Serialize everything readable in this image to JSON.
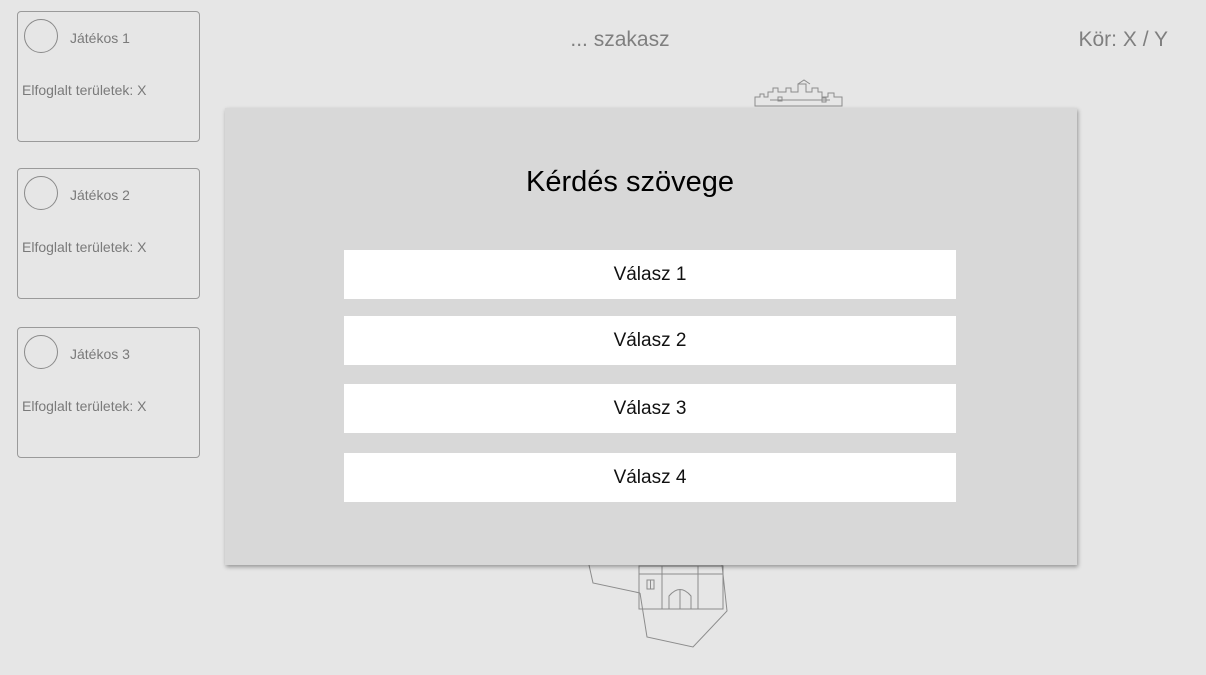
{
  "header": {
    "phase": "... szakasz",
    "round": "Kör: X / Y"
  },
  "players": [
    {
      "name": "Játékos 1",
      "territories": "Elfoglalt területek: X"
    },
    {
      "name": "Játékos 2",
      "territories": "Elfoglalt területek: X"
    },
    {
      "name": "Játékos 3",
      "territories": "Elfoglalt területek: X"
    }
  ],
  "question": {
    "text": "Kérdés szövege",
    "answers": [
      "Válasz 1",
      "Válasz 2",
      "Válasz 3",
      "Válasz 4"
    ]
  },
  "colors": {
    "background": "#e6e6e6",
    "modal": "#d8d8d8",
    "answer_bg": "#ffffff"
  },
  "icons": {
    "map_decoration": "castle-icon"
  }
}
